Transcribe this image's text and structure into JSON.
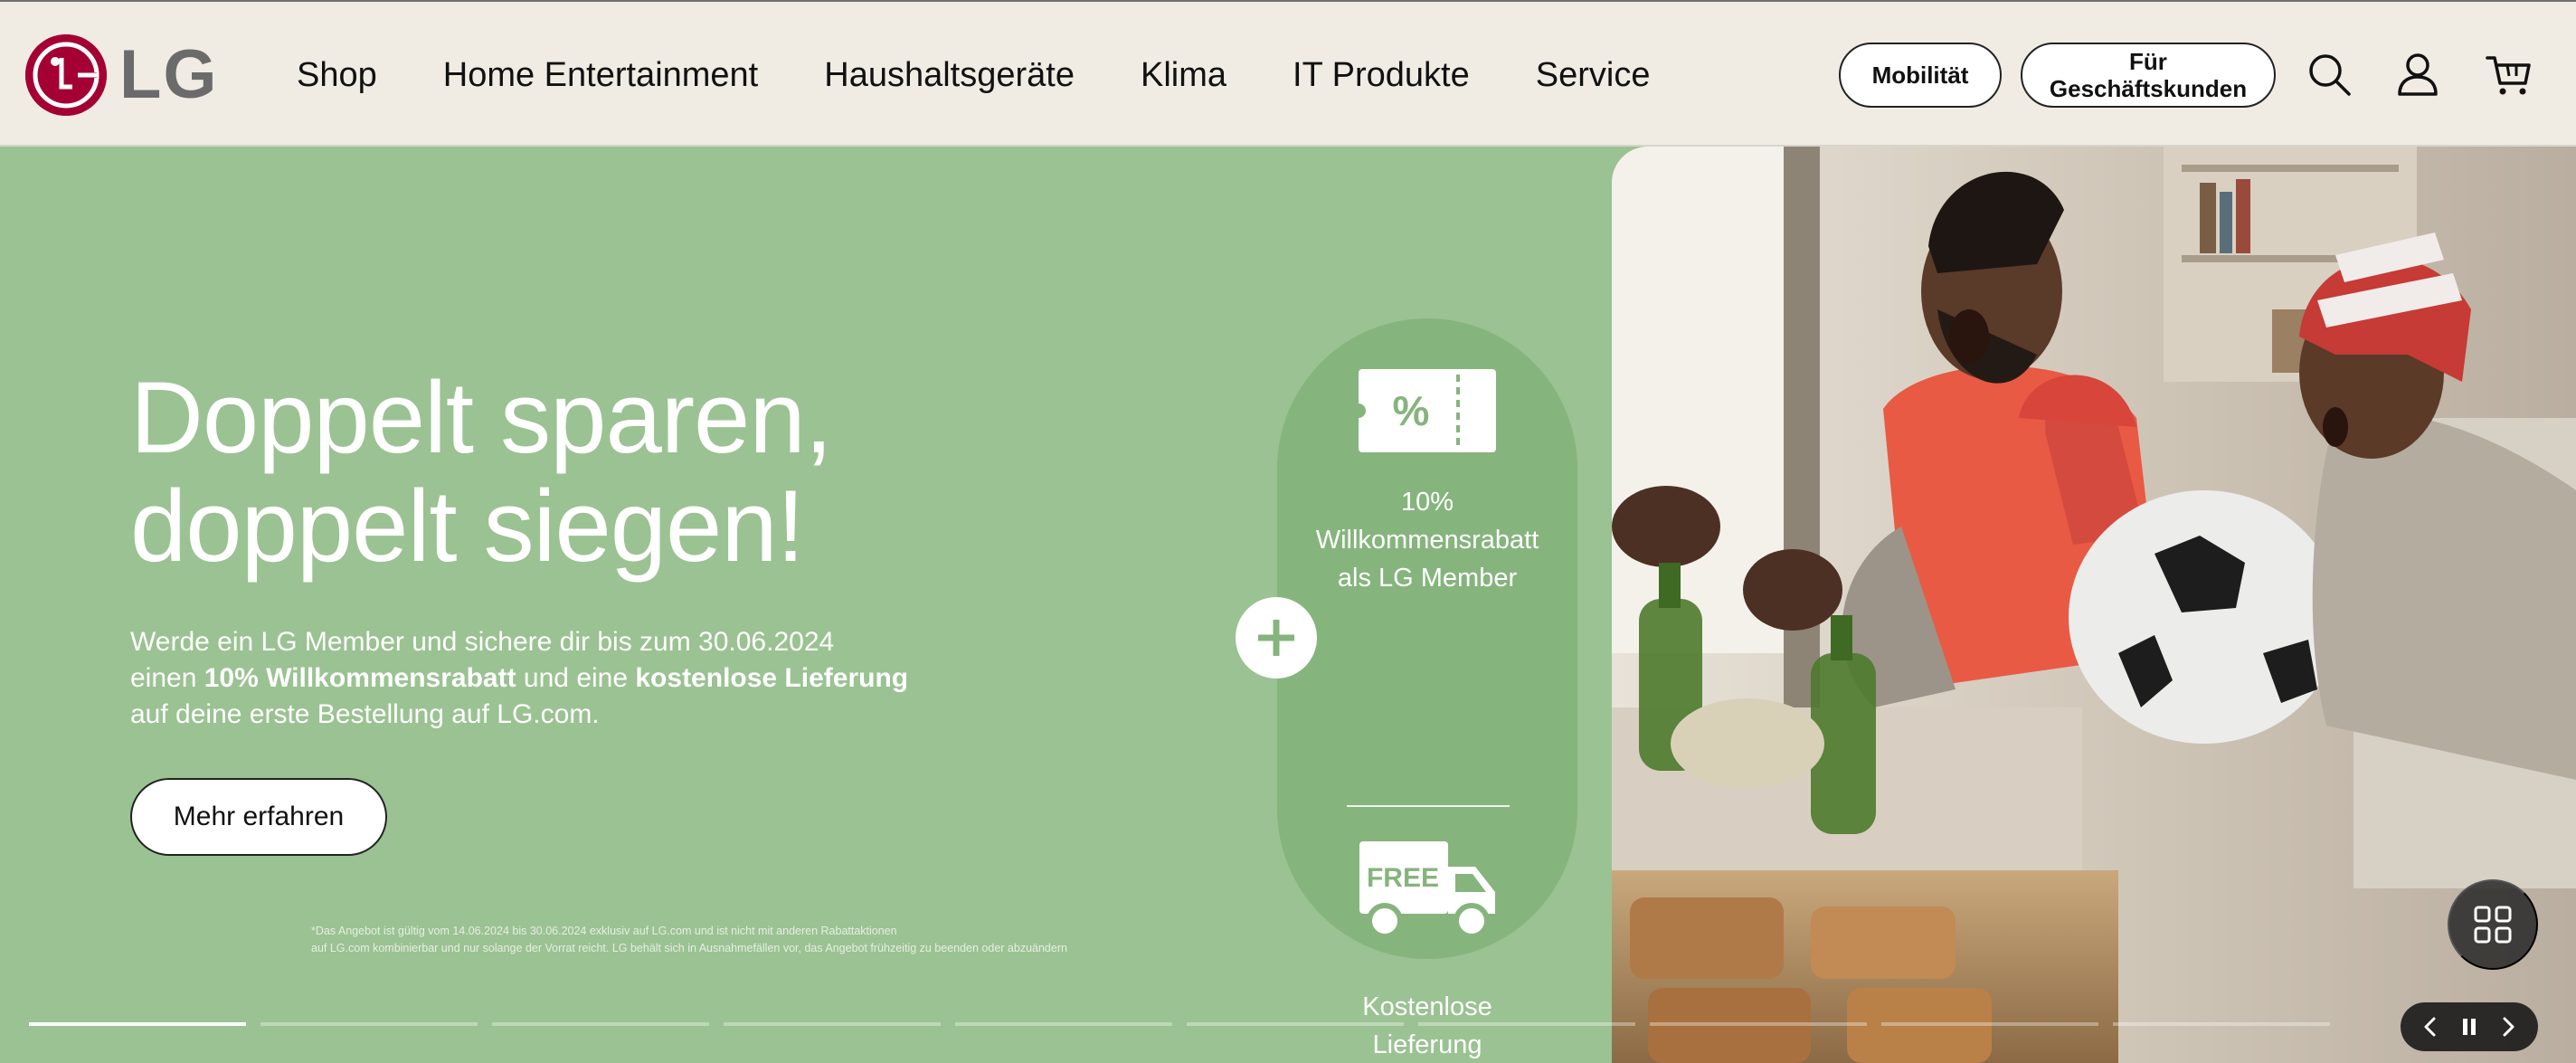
{
  "brand": {
    "name": "LG",
    "logo_color": "#a50034"
  },
  "nav": {
    "items": [
      {
        "label": "Shop"
      },
      {
        "label": "Home Entertainment"
      },
      {
        "label": "Haushaltsgeräte"
      },
      {
        "label": "Klima"
      },
      {
        "label": "IT Produkte"
      },
      {
        "label": "Service"
      }
    ]
  },
  "header_actions": {
    "mobility_label": "Mobilität",
    "business_line1": "Für",
    "business_line2": "Geschäftskunden",
    "search_icon": "search-icon",
    "account_icon": "user-icon",
    "cart_icon": "cart-icon"
  },
  "hero": {
    "headline_line1": "Doppelt sparen,",
    "headline_line2": "doppelt siegen!",
    "body_line1": "Werde ein LG Member und sichere dir bis zum 30.06.2024",
    "body_line2_pre": "einen ",
    "body_line2_bold1": "10% Willkommensrabatt",
    "body_line2_mid": " und eine ",
    "body_line2_bold2": "kostenlose Lieferung",
    "body_line3": "auf deine erste Bestellung auf LG.com.",
    "cta_label": "Mehr erfahren",
    "disclaimer_line1": "*Das Angebot ist gültig vom 14.06.2024 bis 30.06.2024 exklusiv auf LG.com und ist nicht mit anderen Rabattaktionen",
    "disclaimer_line2": "auf LG.com kombinierbar und nur solange der Vorrat reicht. LG behält sich in Ausnahmefällen vor, das Angebot frühzeitig zu beenden oder abzuändern",
    "background_color": "#9bc292",
    "capsule_color": "#86b47d"
  },
  "promo_capsule": {
    "coupon_symbol": "%",
    "coupon_line1": "10%",
    "coupon_line2": "Willkommensrabatt",
    "coupon_line3": "als LG Member",
    "truck_label": "FREE",
    "delivery_line1": "Kostenlose",
    "delivery_line2": "Lieferung"
  },
  "carousel": {
    "slide_count": 10,
    "active_slide": 1,
    "controls": [
      "chevron-left-icon",
      "pause-icon",
      "chevron-right-icon"
    ],
    "overview_icon": "grid-icon"
  }
}
